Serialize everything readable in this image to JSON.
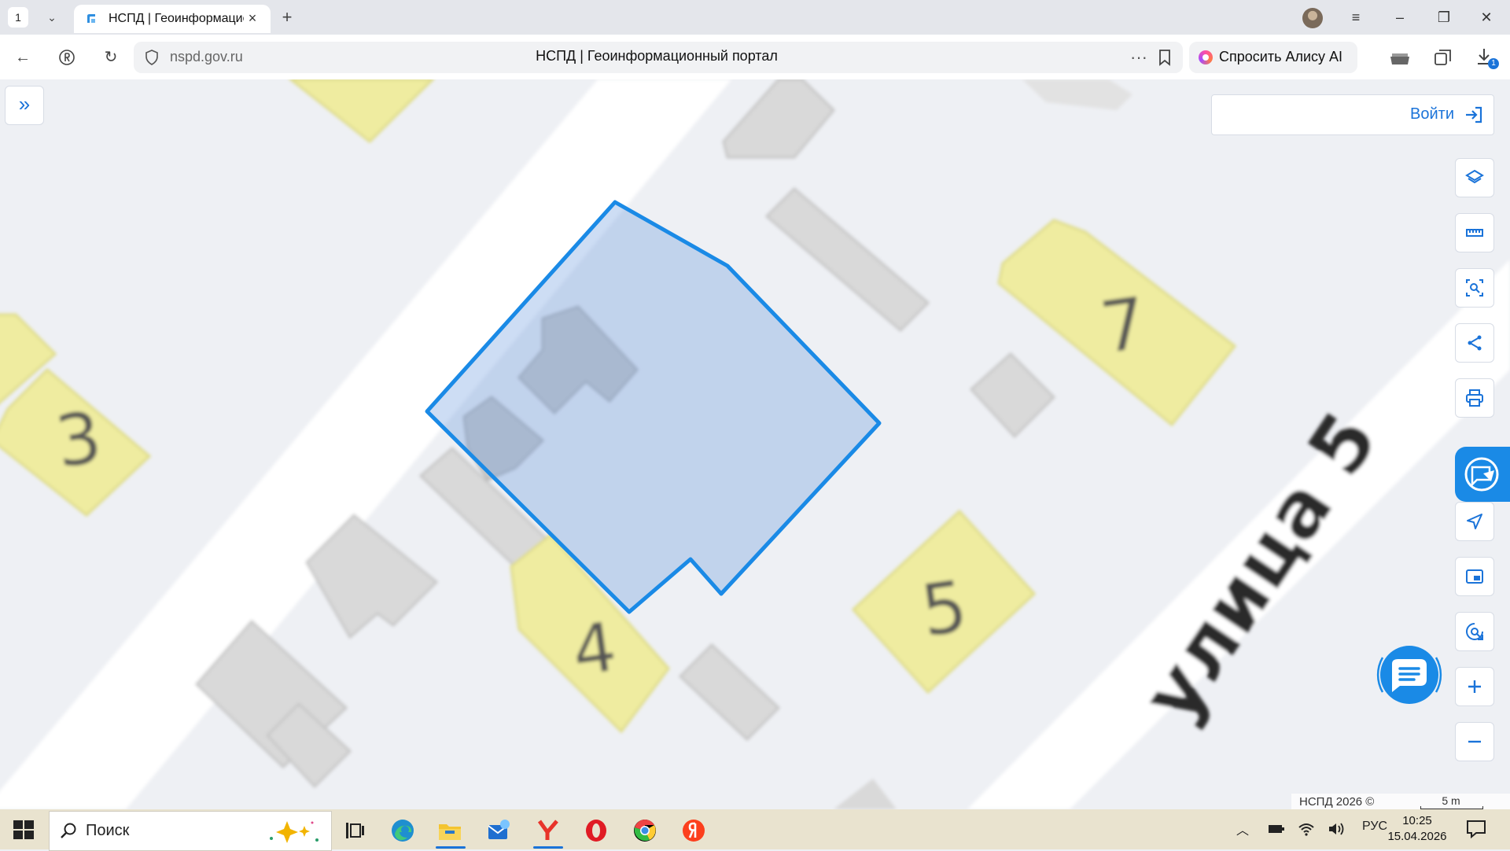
{
  "browser": {
    "tab_count": "1",
    "tab_title": "НСПД | Геоинформационный портал",
    "url": "nspd.gov.ru",
    "page_title": "НСПД | Геоинформационный портал",
    "alisa_label": "Спросить Алису AI",
    "downloads_badge": "1"
  },
  "map": {
    "house_numbers": [
      "3",
      "7",
      "4",
      "5"
    ],
    "street_label": "улица 5",
    "selected_parcel_color": "#1a8ae6",
    "login_label": "Войти",
    "attribution": "НСПД 2026 ©",
    "scale_label": "5 m",
    "tools": [
      "layers-icon",
      "ruler-icon",
      "select-area-icon",
      "share-icon",
      "print-icon",
      "send-location-icon",
      "minimap-icon",
      "locate-icon",
      "zoom-in-icon",
      "zoom-out-icon"
    ]
  },
  "taskbar": {
    "search_placeholder": "Поиск",
    "language": "РУС",
    "time": "10:25",
    "date": "15.04.2026",
    "apps": [
      "task-view-icon",
      "edge-icon",
      "file-explorer-icon",
      "mail-icon",
      "yandex-browser-icon",
      "opera-icon",
      "chromium-icon",
      "yandex-icon"
    ]
  }
}
